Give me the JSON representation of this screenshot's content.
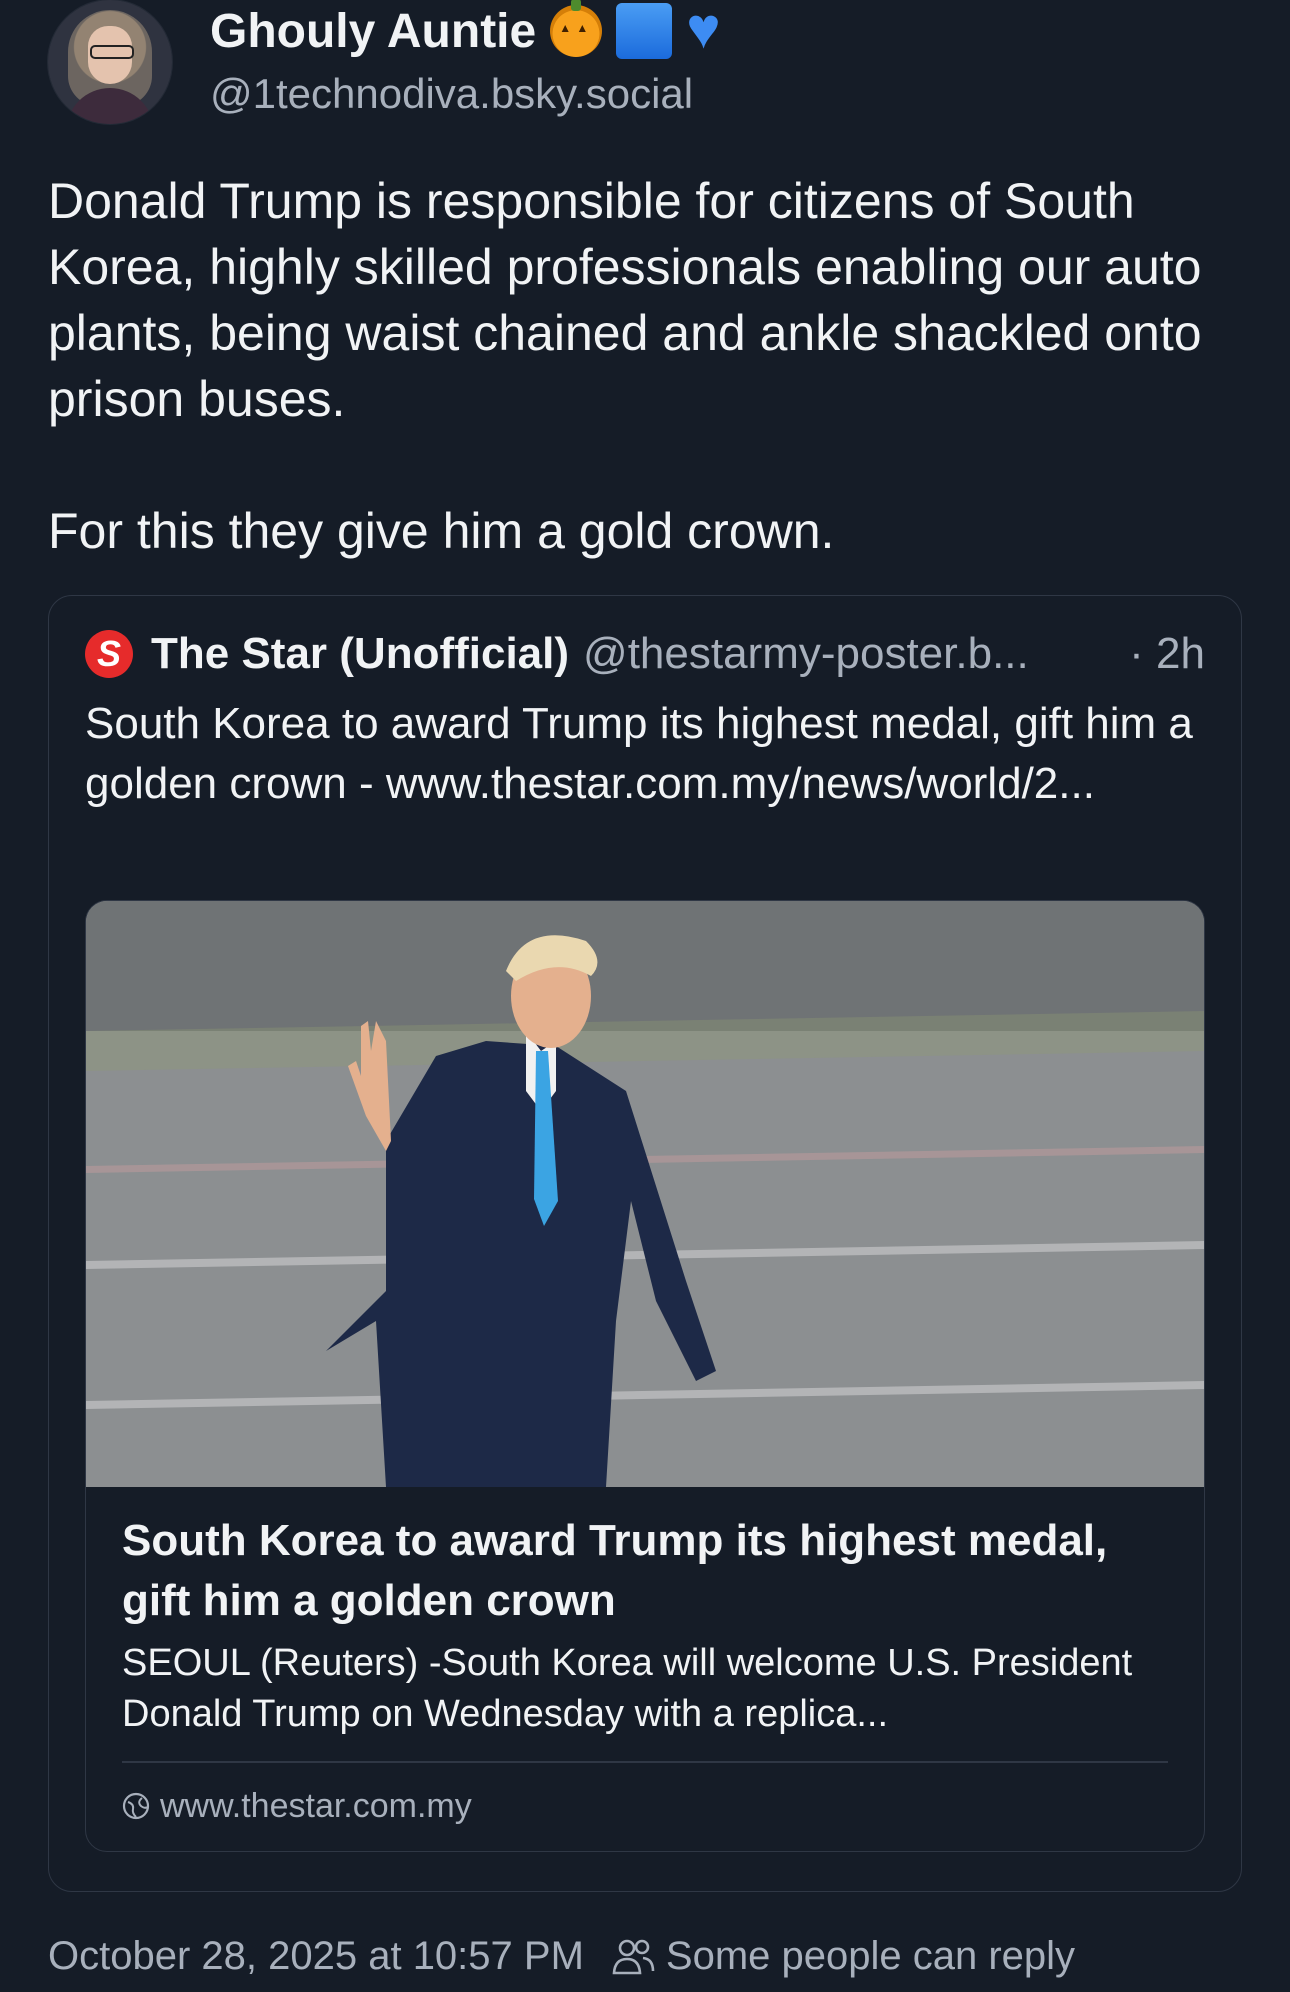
{
  "author": {
    "display_name": "Ghouly Auntie",
    "emojis": [
      "pumpkin-emoji",
      "blue-square-emoji",
      "blue-heart-emoji"
    ],
    "handle": "@1technodiva.bsky.social"
  },
  "post": {
    "paragraphs": [
      "Donald Trump is responsible for citizens of South Korea, highly skilled professionals enabling our auto plants, being waist chained and ankle shackled onto prison buses.",
      "For this they give him a gold crown."
    ]
  },
  "quote": {
    "logo_letter": "S",
    "name": "The Star (Unofficial)",
    "handle": "@thestarmy-poster.b...",
    "time": "· 2h",
    "text": "South Korea to award Trump its highest medal, gift him a golden crown - www.thestar.com.my/news/world/2...",
    "card": {
      "title": "South Korea to award Trump its highest medal, gift him a golden crown",
      "description": "SEOUL (Reuters) -South Korea will welcome U.S. President Donald Trump on Wednesday with a replica...",
      "domain": "www.thestar.com.my"
    }
  },
  "footer": {
    "timestamp": "October 28, 2025 at 10:57 PM",
    "reply_setting": "Some people can reply"
  },
  "colors": {
    "background": "#151c27",
    "text": "#f1f3f5",
    "muted": "#a8b0bc",
    "border": "#2f3745",
    "star_logo": "#e62b2b"
  }
}
